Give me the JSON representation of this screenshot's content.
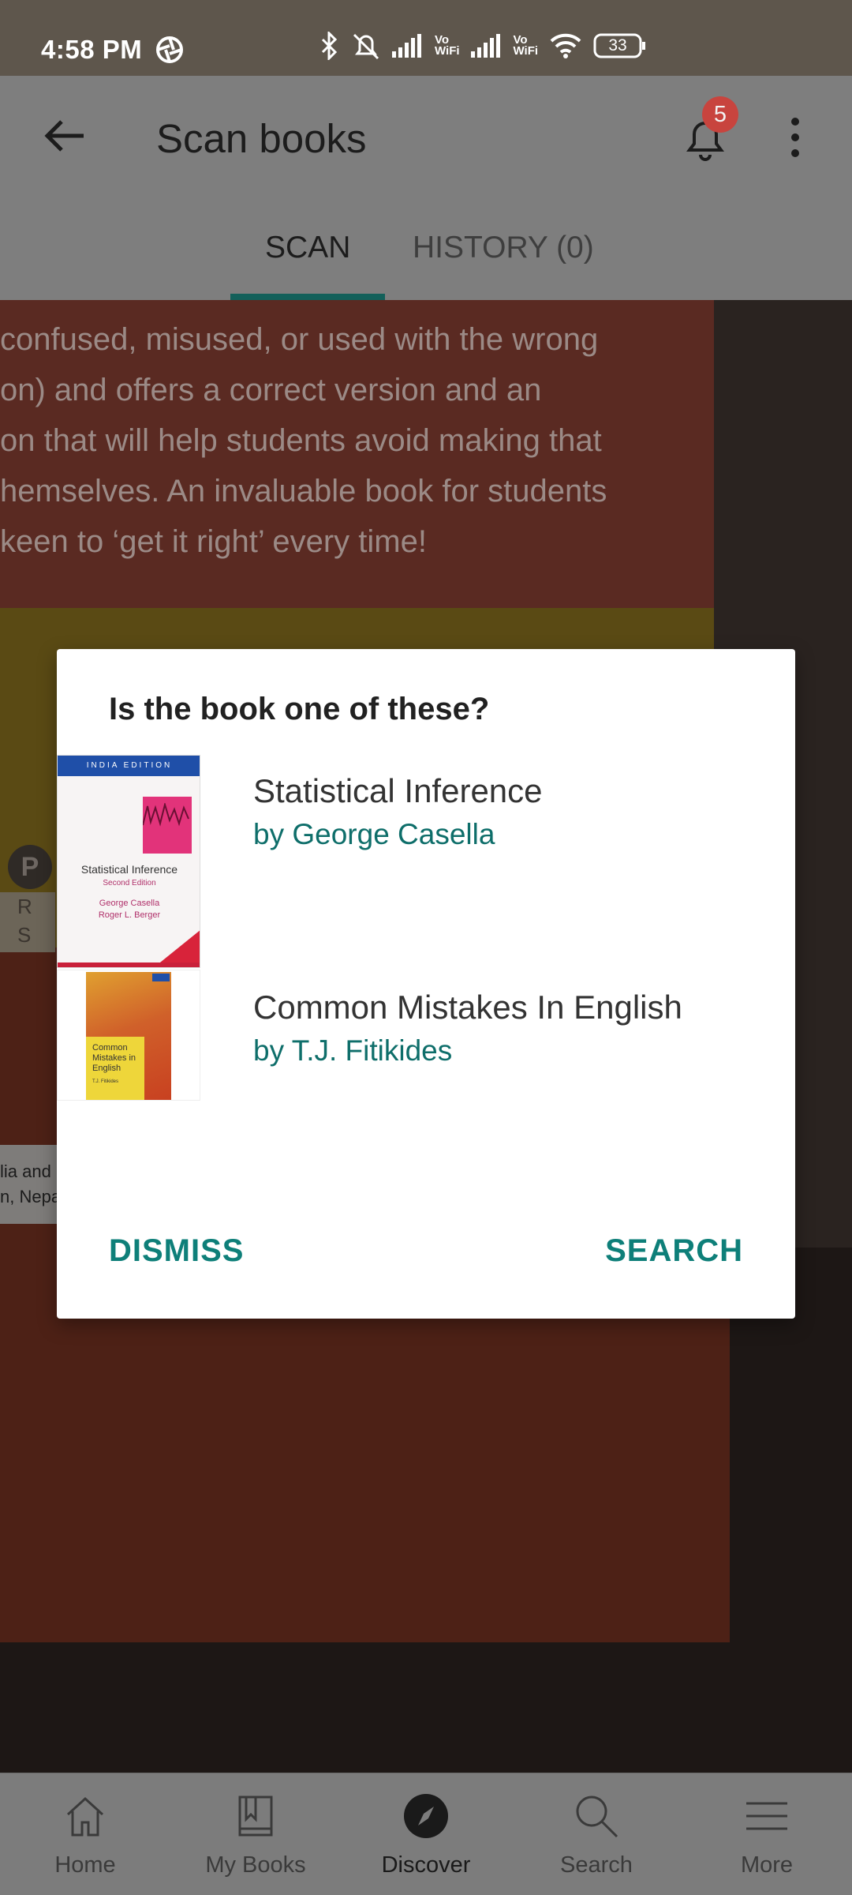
{
  "status_bar": {
    "time": "4:58 PM",
    "battery": "33",
    "vowifi_1": "Vo\nWiFi",
    "vowifi_2": "Vo\nWiFi"
  },
  "app_bar": {
    "title": "Scan books",
    "notification_count": "5"
  },
  "tabs": [
    {
      "label": "SCAN",
      "active": true
    },
    {
      "label": "HISTORY (0)",
      "active": false
    }
  ],
  "camera_text": {
    "lines": [
      "confused, misused, or used with the wrong",
      "on) and offers a correct version and an",
      "on that will help students avoid making that",
      "hemselves. An invaluable book for students",
      "keen to ‘get it right’ every time!"
    ],
    "logo_letter": "P",
    "side_letters": "R\nS",
    "caption": "lia and\nn, Nepa"
  },
  "dialog": {
    "title": "Is the book one of these?",
    "books": [
      {
        "title": "Statistical Inference",
        "author": "by George Casella",
        "cover": {
          "banner": "INDIA EDITION",
          "name": "Statistical Inference",
          "edition": "Second Edition",
          "authors": "George Casella\nRoger L. Berger"
        }
      },
      {
        "title": "Common Mistakes In English",
        "author": "by T.J. Fitikides",
        "cover": {
          "name": "Common\nMistakes in\nEnglish",
          "author": "T.J. Fitikides"
        }
      }
    ],
    "dismiss_label": "DISMISS",
    "search_label": "SEARCH"
  },
  "bottom_nav": [
    {
      "label": "Home",
      "icon": "home-icon",
      "active": false
    },
    {
      "label": "My Books",
      "icon": "my-books-icon",
      "active": false
    },
    {
      "label": "Discover",
      "icon": "compass-icon",
      "active": true
    },
    {
      "label": "Search",
      "icon": "search-icon",
      "active": false
    },
    {
      "label": "More",
      "icon": "menu-icon",
      "active": false
    }
  ],
  "colors": {
    "accent": "#0e7f79",
    "tab_indicator": "#13605a",
    "badge": "#c8443e"
  }
}
